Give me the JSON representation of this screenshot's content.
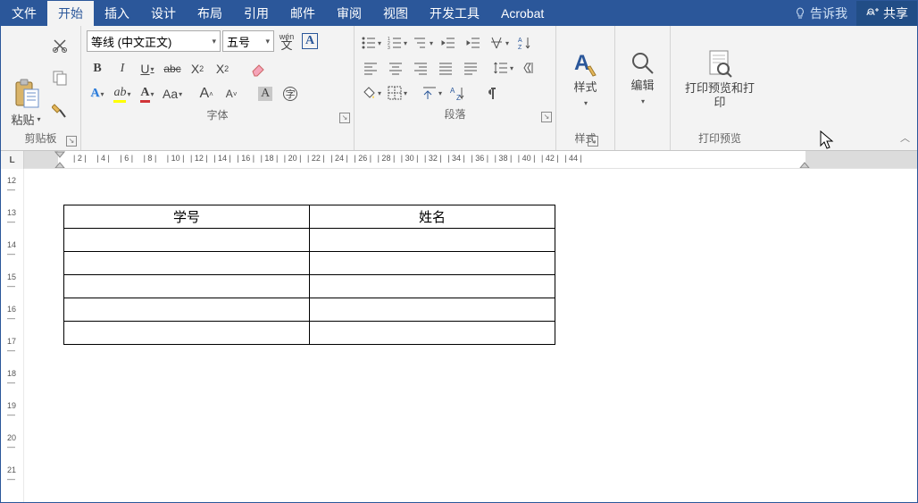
{
  "menubar": {
    "tabs": [
      "文件",
      "开始",
      "插入",
      "设计",
      "布局",
      "引用",
      "邮件",
      "审阅",
      "视图",
      "开发工具",
      "Acrobat"
    ],
    "active_index": 1,
    "tell_me": "告诉我",
    "share": "共享"
  },
  "ribbon": {
    "clipboard": {
      "label": "剪贴板",
      "paste": "粘贴"
    },
    "font": {
      "label": "字体",
      "font_name": "等线 (中文正文)",
      "font_size": "五号",
      "wen_label": "wén",
      "bold": "B",
      "italic": "I",
      "underline": "U",
      "strike": "abc",
      "x2": "X",
      "sub": "2",
      "sup": "2",
      "Aa": "Aa",
      "grow": "A",
      "shrink": "A",
      "clear": "A"
    },
    "paragraph": {
      "label": "段落"
    },
    "styles": {
      "label": "样式",
      "button": "样式"
    },
    "edit": {
      "label": "",
      "button": "编辑"
    },
    "preview": {
      "label": "打印预览",
      "button": "打印预览和打印"
    }
  },
  "ruler": {
    "corner": "L",
    "h_ticks": [
      2,
      4,
      6,
      8,
      10,
      12,
      14,
      16,
      18,
      20,
      22,
      24,
      26,
      28,
      30,
      32,
      34,
      36,
      38,
      40,
      42,
      44
    ],
    "v_ticks": [
      12,
      13,
      14,
      15,
      16,
      17,
      18,
      19,
      20,
      21
    ]
  },
  "document": {
    "table": {
      "rows": 6,
      "cols": 2,
      "data": [
        [
          "学号",
          "姓名"
        ],
        [
          "",
          ""
        ],
        [
          "",
          ""
        ],
        [
          "",
          ""
        ],
        [
          "",
          ""
        ],
        [
          "",
          ""
        ]
      ]
    }
  }
}
